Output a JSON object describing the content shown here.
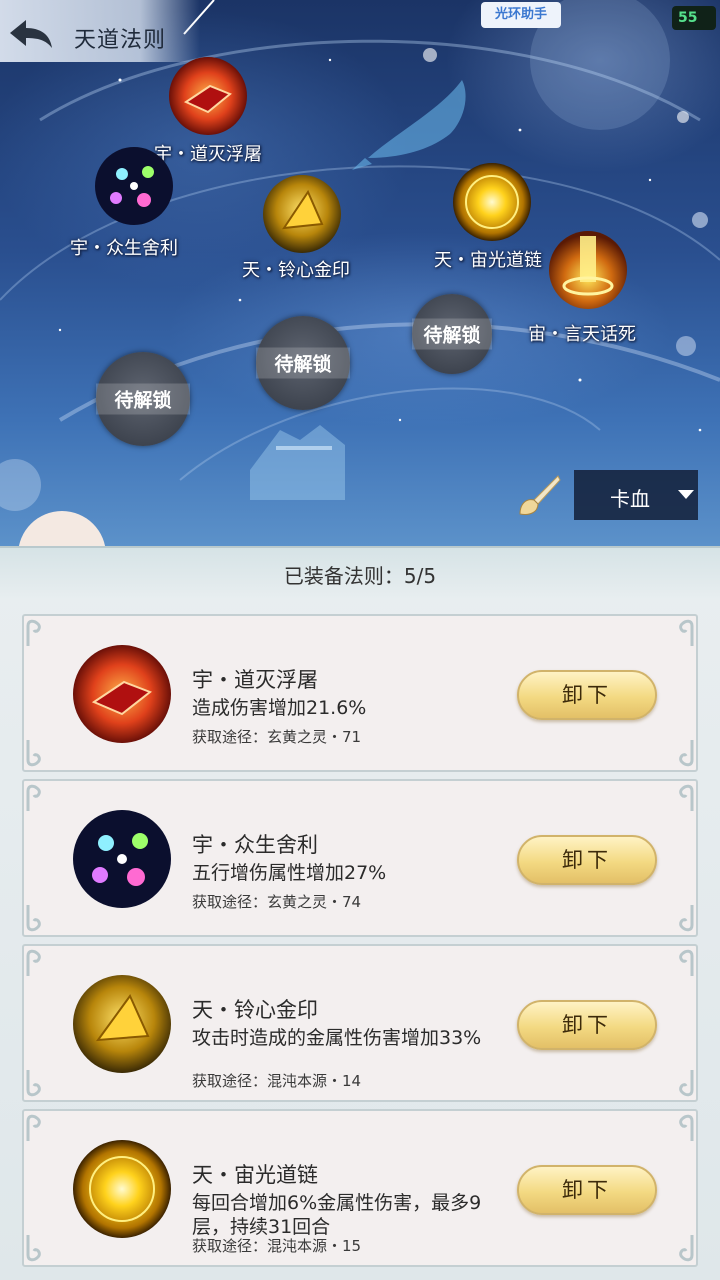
{
  "header": {
    "title": "天道法则"
  },
  "status": {
    "helper_label": "光环助手",
    "battery": "55"
  },
  "map": {
    "nodes": [
      {
        "label": "宇・道灭浮屠",
        "icon": "red-crystal-icon"
      },
      {
        "label": "宇・众生舍利",
        "icon": "cosmic-orbs-icon"
      },
      {
        "label": "天・铃心金印",
        "icon": "gold-gem-icon"
      },
      {
        "label": "天・宙光道链",
        "icon": "golden-sun-icon"
      },
      {
        "label": "宙・言天话死",
        "icon": "golden-pillar-icon"
      }
    ],
    "locked_label": "待解锁",
    "filter": {
      "selected": "卡血"
    }
  },
  "panel": {
    "title": "已装备法则：5/5",
    "unequip_label": "卸下",
    "items": [
      {
        "name": "宇・道灭浮屠",
        "desc": "造成伤害增加21.6%",
        "source": "获取途径：玄黄之灵・71",
        "icon": "red-crystal-icon"
      },
      {
        "name": "宇・众生舍利",
        "desc": "五行增伤属性增加27%",
        "source": "获取途径：玄黄之灵・74",
        "icon": "cosmic-orbs-icon"
      },
      {
        "name": "天・铃心金印",
        "desc": "攻击时造成的金属性伤害增加33%",
        "source": "获取途径：混沌本源・14",
        "icon": "gold-gem-icon"
      },
      {
        "name": "天・宙光道链",
        "desc": "每回合增加6%金属性伤害，最多9层，持续31回合",
        "source": "获取途径：混沌本源・15",
        "icon": "golden-sun-icon"
      }
    ]
  },
  "colors": {
    "button_gold": "#f3d982",
    "panel_bg": "#e9eef0",
    "sky": "#2a4f8f"
  }
}
